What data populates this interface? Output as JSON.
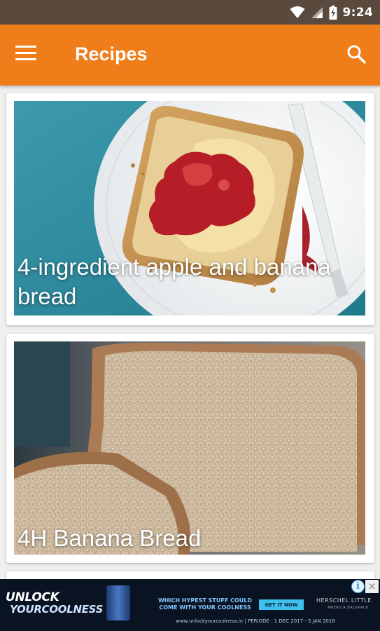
{
  "status_bar": {
    "time": "9:24",
    "icons": [
      "wifi-icon",
      "cell-signal-icon",
      "battery-charging-icon"
    ]
  },
  "app_bar": {
    "title": "Recipes",
    "menu_icon": "hamburger-menu-icon",
    "search_icon": "search-icon",
    "background_color": "#ee7d1a"
  },
  "recipes": [
    {
      "title": "4-ingredient apple and banana bread"
    },
    {
      "title": "4H Banana Bread"
    }
  ],
  "ad": {
    "headline_1": "UNLOCK",
    "headline_2": "YOURCOOLNESS",
    "tagline": "WHICH HYPEST STUFF COULD COME WITH YOUR COOLNESS",
    "cta": "GET IT NOW",
    "brand": "HERSCHEL LITTLE",
    "brand_sub": "AMERICA BACKPACK",
    "footer": "www.unlockyourcoolness.ie | PERIODE : 1 DEC 2017 - 5 JAN 2018",
    "info_label": "i",
    "close_label": "×"
  }
}
